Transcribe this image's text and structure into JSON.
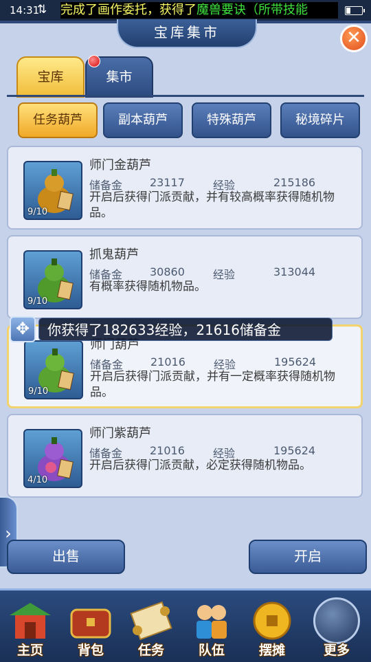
{
  "status_bar": {
    "time": "14:31",
    "marquee_part1": "完成了画作委托，获得了",
    "marquee_part2": "魔兽要诀（所带技能"
  },
  "window": {
    "title": "宝库集市",
    "close_icon": "close-x-icon"
  },
  "tabs": [
    {
      "label": "宝库",
      "active": true
    },
    {
      "label": "集市",
      "active": false,
      "badge": true
    }
  ],
  "subtabs": [
    {
      "label": "任务葫芦",
      "active": true
    },
    {
      "label": "副本葫芦",
      "active": false
    },
    {
      "label": "特殊葫芦",
      "active": false
    },
    {
      "label": "秘境碎片",
      "active": false
    }
  ],
  "items": [
    {
      "name": "师门金葫芦",
      "count": "9/10",
      "reserve_label": "储备金",
      "reserve": "23117",
      "exp_label": "经验",
      "exp": "215186",
      "desc": "开启后获得门派贡献，并有较高概率获得随机物品。",
      "icon": "gold-gourd-icon",
      "color": "#c98a1a"
    },
    {
      "name": "抓鬼葫芦",
      "count": "9/10",
      "reserve_label": "储备金",
      "reserve": "30860",
      "exp_label": "经验",
      "exp": "313044",
      "desc": "有概率获得随机物品。",
      "icon": "green-gourd-icon",
      "color": "#4f9a2a"
    },
    {
      "name": "师门葫芦",
      "count": "9/10",
      "reserve_label": "储备金",
      "reserve": "21016",
      "exp_label": "经验",
      "exp": "195624",
      "desc": "开启后获得门派贡献，并有一定概率获得随机物品。",
      "icon": "green-gourd-icon",
      "color": "#5aa330"
    },
    {
      "name": "师门紫葫芦",
      "count": "4/10",
      "reserve_label": "储备金",
      "reserve": "21016",
      "exp_label": "经验",
      "exp": "195624",
      "desc": "开启后获得门派贡献，必定获得随机物品。",
      "icon": "purple-gourd-icon",
      "color": "#8b4cc2"
    }
  ],
  "toast": "你获得了182633经验，21616储备金",
  "buttons": {
    "sell": "出售",
    "open": "开启"
  },
  "dock": [
    {
      "label": "主页",
      "icon": "home-pavilion-icon",
      "color": "#d8472c"
    },
    {
      "label": "背包",
      "icon": "treasure-chest-icon",
      "color": "#b3391f"
    },
    {
      "label": "任务",
      "icon": "scroll-icon",
      "color": "#e8c67a"
    },
    {
      "label": "队伍",
      "icon": "team-figures-icon",
      "color": "#e89b2c"
    },
    {
      "label": "摆摊",
      "icon": "coin-icon",
      "color": "#f0b622"
    },
    {
      "label": "更多",
      "icon": "more-swirl-icon",
      "color": "#9fb7e0"
    }
  ]
}
